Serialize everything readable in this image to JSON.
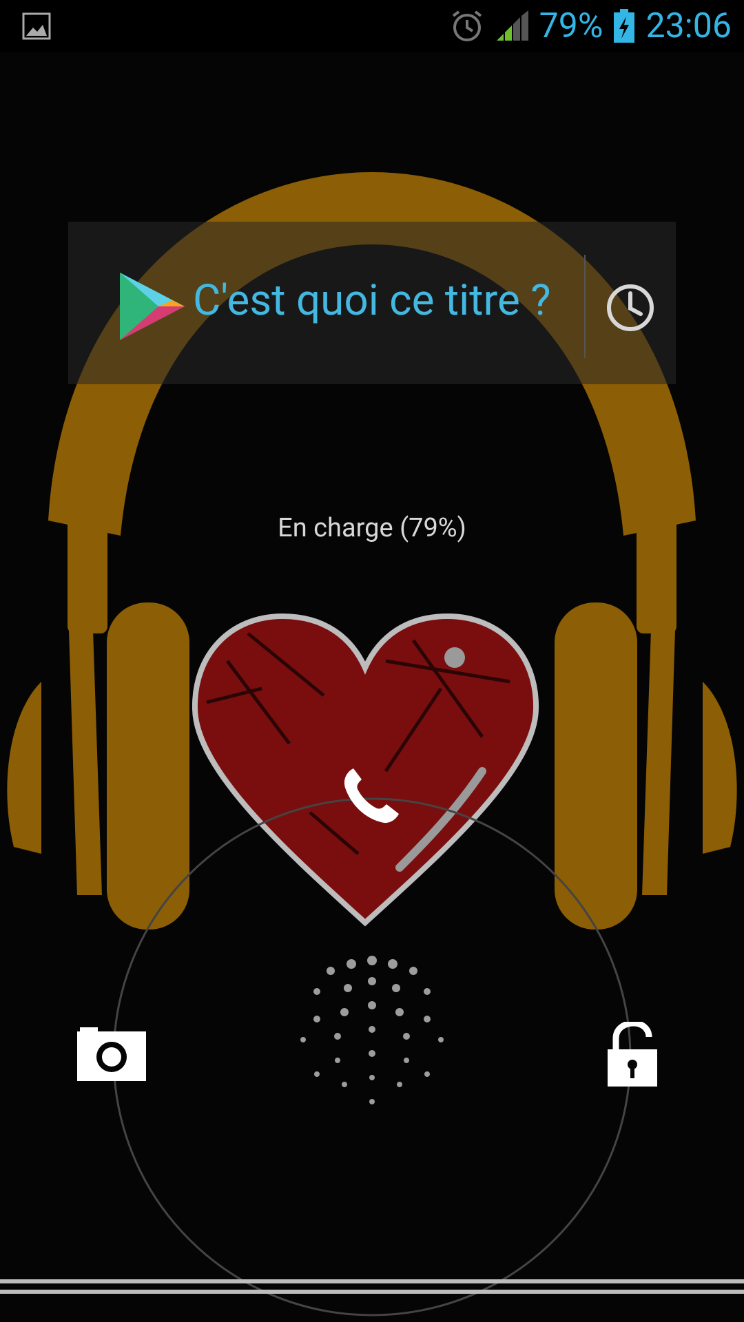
{
  "status_bar": {
    "battery_percent": "79%",
    "time": "23:06",
    "icons": [
      "gallery-notification-icon",
      "alarm-icon",
      "signal-icon",
      "battery-charging-icon"
    ],
    "accent_color": "#33b5e5"
  },
  "widget": {
    "title": "C'est quoi ce titre ?",
    "icons": [
      "google-play-icon",
      "history-clock-icon"
    ]
  },
  "lockscreen": {
    "charging_status": "En charge (79%)",
    "targets": [
      "camera-icon",
      "phone-icon",
      "unlock-icon"
    ]
  },
  "colors": {
    "headphones": "#8c5e05",
    "heart": "#8b1010",
    "widget_text": "#43b8e0"
  }
}
